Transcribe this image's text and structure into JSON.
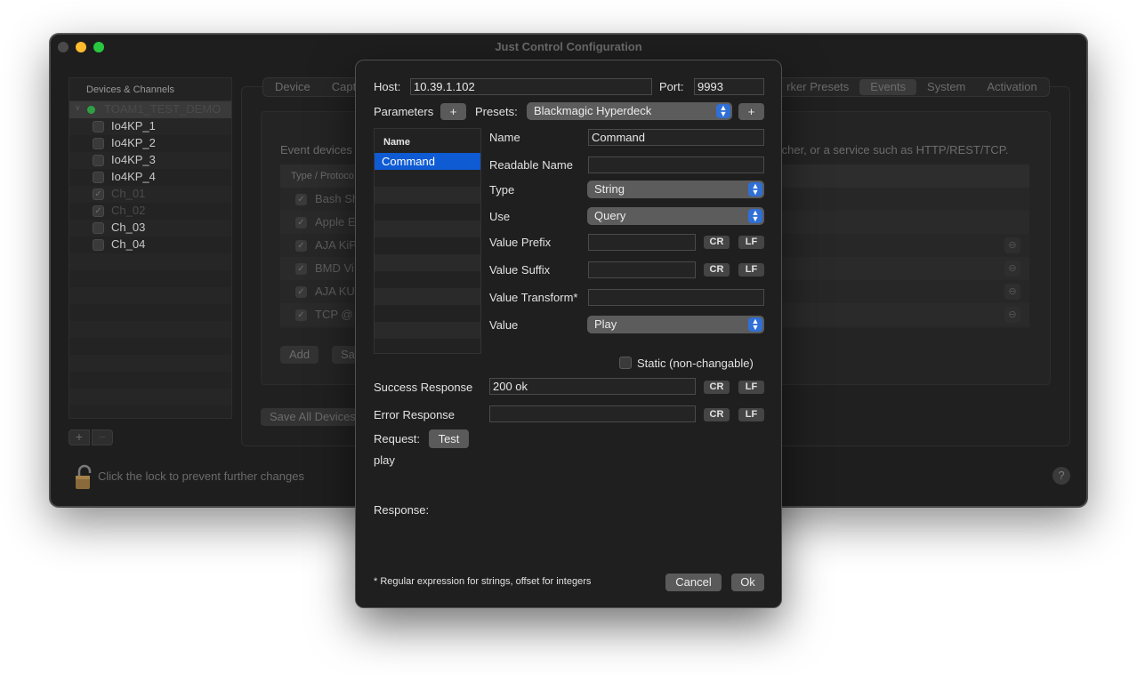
{
  "window": {
    "title": "Just Control Configuration",
    "lock_text": "Click the lock to prevent further changes",
    "help": "?"
  },
  "sidebar": {
    "header": "Devices & Channels",
    "group": "TOAM1_TEST_DEMO",
    "items": [
      {
        "label": "Io4KP_1",
        "checked": false,
        "dim": false
      },
      {
        "label": "Io4KP_2",
        "checked": false,
        "dim": false
      },
      {
        "label": "Io4KP_3",
        "checked": false,
        "dim": false
      },
      {
        "label": "Io4KP_4",
        "checked": false,
        "dim": false
      },
      {
        "label": "Ch_01",
        "checked": true,
        "dim": true
      },
      {
        "label": "Ch_02",
        "checked": true,
        "dim": true
      },
      {
        "label": "Ch_03",
        "checked": false,
        "dim": false
      },
      {
        "label": "Ch_04",
        "checked": false,
        "dim": false
      }
    ],
    "plus": "+",
    "minus": "−"
  },
  "tabs": {
    "device": "Device",
    "capture": "Capt",
    "marker_presets": "rker Presets",
    "events": "Events",
    "system": "System",
    "activation": "Activation"
  },
  "events": {
    "desc_left": "Event devices",
    "desc_right": "tcher, or a service such as HTTP/REST/TCP.",
    "header": "Type / Protoco",
    "rows": [
      "Bash Sh",
      "Apple E",
      "AJA KiP",
      "BMD Vi",
      "AJA KU",
      "TCP @"
    ],
    "add": "Add",
    "save": "Sa",
    "save_all": "Save All Devices"
  },
  "sheet": {
    "host_label": "Host:",
    "host_value": "10.39.1.102",
    "port_label": "Port:",
    "port_value": "9993",
    "parameters_label": "Parameters",
    "presets_label": "Presets:",
    "preset_value": "Blackmagic Hyperdeck",
    "plus": "+",
    "list_header": "Name",
    "list_selected": "Command",
    "name_label": "Name",
    "name_value": "Command",
    "readable_name_label": "Readable Name",
    "readable_name_value": "",
    "type_label": "Type",
    "type_value": "String",
    "use_label": "Use",
    "use_value": "Query",
    "value_prefix_label": "Value Prefix",
    "value_suffix_label": "Value Suffix",
    "value_transform_label": "Value Transform*",
    "value_label": "Value",
    "value_value": "Play",
    "cr": "CR",
    "lf": "LF",
    "static_label": "Static (non-changable)",
    "success_label": "Success Response",
    "success_value": "200 ok",
    "error_label": "Error Response",
    "error_value": "",
    "request_label": "Request:",
    "test_button": "Test",
    "request_value": "play",
    "response_label": "Response:",
    "footnote": "* Regular expression for strings, offset for integers",
    "cancel": "Cancel",
    "ok": "Ok"
  },
  "colors": {
    "accent": "#0e5bd4",
    "popup_arrow": "#2f6fd6",
    "status_green": "#2ea043",
    "minimize_yellow": "#febc2e",
    "zoom_green": "#28c840"
  }
}
